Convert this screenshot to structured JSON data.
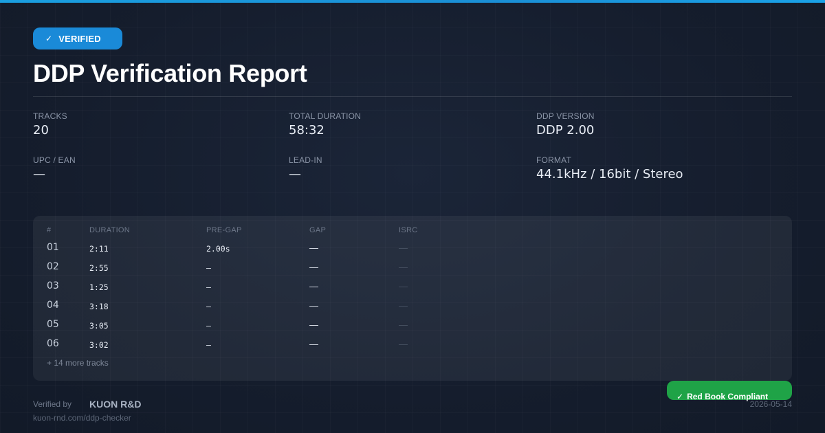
{
  "badge": {
    "icon": "check-icon",
    "label": "VERIFIED",
    "color": "#1a8ad8"
  },
  "title": "DDP Verification Report",
  "stats": [
    {
      "label": "TRACKS",
      "value": "20"
    },
    {
      "label": "TOTAL DURATION",
      "value": "58:32"
    },
    {
      "label": "DDP VERSION",
      "value": "DDP 2.00"
    },
    {
      "label": "UPC / EAN",
      "value": "—"
    },
    {
      "label": "LEAD-IN",
      "value": "—"
    },
    {
      "label": "FORMAT",
      "value": "44.1kHz / 16bit / Stereo"
    }
  ],
  "table": {
    "headers": [
      "#",
      "DURATION",
      "PRE-GAP",
      "GAP",
      "ISRC"
    ],
    "rows": [
      {
        "num": "01",
        "duration": "2:11",
        "pregap": "2.00s",
        "gap": "—",
        "isrc": "—"
      },
      {
        "num": "02",
        "duration": "2:55",
        "pregap": "—",
        "gap": "—",
        "isrc": "—"
      },
      {
        "num": "03",
        "duration": "1:25",
        "pregap": "—",
        "gap": "—",
        "isrc": "—"
      },
      {
        "num": "04",
        "duration": "3:18",
        "pregap": "—",
        "gap": "—",
        "isrc": "—"
      },
      {
        "num": "05",
        "duration": "3:05",
        "pregap": "—",
        "gap": "—",
        "isrc": "—"
      },
      {
        "num": "06",
        "duration": "3:02",
        "pregap": "—",
        "gap": "—",
        "isrc": "—"
      }
    ],
    "more": "+ 14 more tracks"
  },
  "footer": {
    "verified_by": "Verified by",
    "brand": "KUON R&D",
    "url": "kuon-rnd.com/ddp-checker",
    "date": "2026-05-14",
    "compliant_label": "Red Book Compliant",
    "compliant_color": "#1fa347"
  },
  "colors": {
    "accent": "#1a8ad8",
    "background": "#141c2c"
  }
}
